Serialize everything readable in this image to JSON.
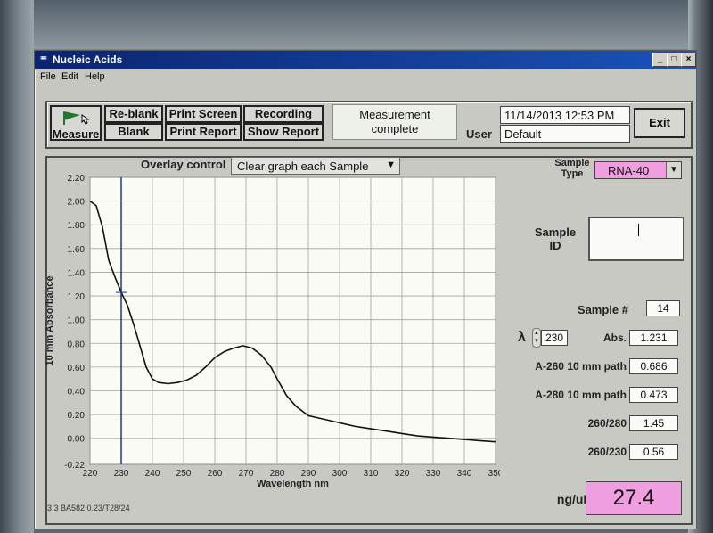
{
  "window": {
    "title": "Nucleic Acids"
  },
  "menu": [
    "File",
    "Edit",
    "Help"
  ],
  "toolbar": {
    "measure": "Measure",
    "reblank": "Re-blank",
    "blank": "Blank",
    "print_screen": "Print Screen",
    "print_report": "Print Report",
    "recording": "Recording",
    "show_report": "Show Report",
    "status_line1": "Measurement",
    "status_line2": "complete",
    "datetime": "11/14/2013  12:53 PM",
    "user_label": "User",
    "user_value": "Default",
    "exit": "Exit"
  },
  "overlay": {
    "label": "Overlay control",
    "value": "Clear graph each Sample"
  },
  "sample": {
    "type_label_1": "Sample",
    "type_label_2": "Type",
    "type_value": "RNA-40",
    "id_label_1": "Sample",
    "id_label_2": "ID",
    "id_value": "",
    "number_label": "Sample #",
    "number_value": "14"
  },
  "readouts": {
    "lambda_symbol": "λ",
    "lambda_value": "230",
    "abs_label": "Abs.",
    "abs_value": "1.231",
    "a260_label": "A-260 10 mm path",
    "a260_value": "0.686",
    "a280_label": "A-280 10 mm path",
    "a280_value": "0.473",
    "r260_280_label": "260/280",
    "r260_280_value": "1.45",
    "r260_230_label": "260/230",
    "r260_230_value": "0.56",
    "conc_label": "ng/uL",
    "conc_value": "27.4"
  },
  "footer": "3.3 BA582 0.23/T28/24",
  "colors": {
    "sample_type_bg": "#ef9fe0",
    "cursor": "#1f3b8f",
    "plot_bg": "#fbfbf6",
    "grid": "#9fa79a"
  },
  "chart_data": {
    "type": "line",
    "xlabel": "Wavelength nm",
    "ylabel": "10 mm Absorbance",
    "xlim": [
      220,
      350
    ],
    "ylim": [
      -0.22,
      2.2
    ],
    "x_ticks": [
      220,
      230,
      240,
      250,
      260,
      270,
      280,
      290,
      300,
      310,
      320,
      330,
      340,
      350
    ],
    "y_ticks": [
      "2.20",
      "2.00",
      "1.80",
      "1.60",
      "1.40",
      "1.20",
      "1.00",
      "0.80",
      "0.60",
      "0.40",
      "0.20",
      "0.00",
      "-0.22"
    ],
    "grid": true,
    "cursor_x": 230,
    "series": [
      {
        "x": [
          220,
          222,
          224,
          226,
          228,
          230,
          232,
          234,
          236,
          238,
          240,
          242,
          245,
          248,
          251,
          254,
          257,
          260,
          263,
          266,
          269,
          272,
          275,
          278,
          280,
          283,
          286,
          290,
          295,
          300,
          305,
          310,
          315,
          320,
          325,
          330,
          335,
          340,
          345,
          350
        ],
        "y": [
          2.0,
          1.96,
          1.78,
          1.5,
          1.36,
          1.23,
          1.12,
          0.96,
          0.78,
          0.6,
          0.5,
          0.47,
          0.46,
          0.47,
          0.49,
          0.53,
          0.6,
          0.68,
          0.73,
          0.76,
          0.78,
          0.76,
          0.7,
          0.6,
          0.5,
          0.36,
          0.27,
          0.19,
          0.16,
          0.13,
          0.1,
          0.08,
          0.06,
          0.04,
          0.02,
          0.01,
          0.0,
          -0.01,
          -0.02,
          -0.03
        ]
      }
    ]
  }
}
